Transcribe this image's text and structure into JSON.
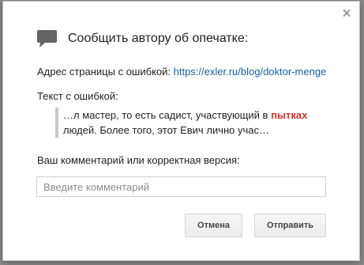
{
  "dialog": {
    "title": "Сообщить автору об опечатке:",
    "close_glyph": "×",
    "url_label": "Адрес страницы с ошибкой:",
    "url_value": "https://exler.ru/blog/doktor-menge",
    "text_label": "Текст с ошибкой:",
    "quote": {
      "before": "…л мастер, то есть садист, участвующий в ",
      "highlight": "пытках",
      "after": " людей. Более того, этот Евич лично учас…"
    },
    "comment_label": "Ваш комментарий или корректная версия:",
    "comment_placeholder": "Введите комментарий",
    "comment_value": "",
    "buttons": {
      "cancel": "Отмена",
      "send": "Отправить"
    }
  },
  "icons": {
    "header": "speech-bubble-icon",
    "close": "close-icon"
  },
  "colors": {
    "link": "#1a5fa8",
    "highlight": "#d0342c",
    "overlay": "#6d6d6d",
    "dialog_bg": "#ffffff"
  }
}
